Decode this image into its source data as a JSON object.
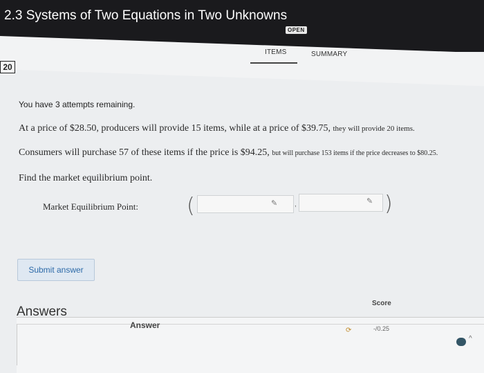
{
  "header": {
    "title": "2.3 Systems of Two Equations in Two Unknowns",
    "badge": "OPEN"
  },
  "tabs": [
    {
      "label": "ITEMS",
      "active": true
    },
    {
      "label": "SUMMARY",
      "active": false
    }
  ],
  "question": {
    "number": "20",
    "attempts_text": "You have 3 attempts remaining.",
    "line1_main": "At a price of $28.50, producers will provide 15 items, while at a price of $39.75, ",
    "line1_small": "they will provide 20 items.",
    "line2_main": "Consumers will purchase 57 of these items if the price is $94.25, ",
    "line2_small": "but will purchase 153 items if the price decreases to $80.25.",
    "line3": "Find the market equilibrium point.",
    "mep_label": "Market Equilibrium Point:",
    "open_paren": "(",
    "close_paren": ")",
    "separator": ",",
    "input1_value": "",
    "input2_value": ""
  },
  "submit_label": "Submit answer",
  "answers": {
    "heading": "Answers",
    "col_answer": "Answer",
    "col_score": "Score",
    "score_value": "-/0.25"
  },
  "colors": {
    "header_bg": "#1a1a1d",
    "submit_text": "#2d6aa8",
    "submit_bg": "#dfe8f2"
  }
}
